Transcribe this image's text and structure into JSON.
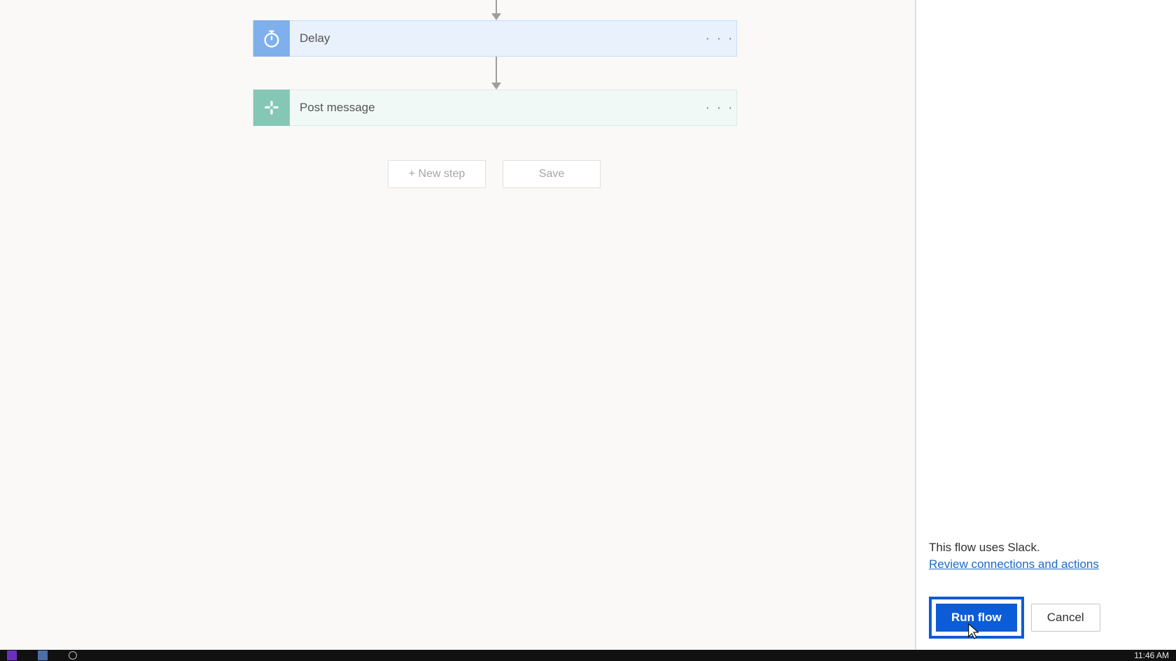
{
  "flow": {
    "steps": [
      {
        "label": "Delay",
        "icon": "stopwatch-icon",
        "color": "#7fb0eb"
      },
      {
        "label": "Post message",
        "icon": "slack-icon",
        "color": "#85c7b5"
      }
    ],
    "actions": {
      "new_step": "+ New step",
      "save": "Save"
    }
  },
  "panel": {
    "info_text": "This flow uses Slack.",
    "review_link": "Review connections and actions",
    "run_label": "Run flow",
    "cancel_label": "Cancel"
  },
  "taskbar": {
    "time": "11:46 AM"
  }
}
